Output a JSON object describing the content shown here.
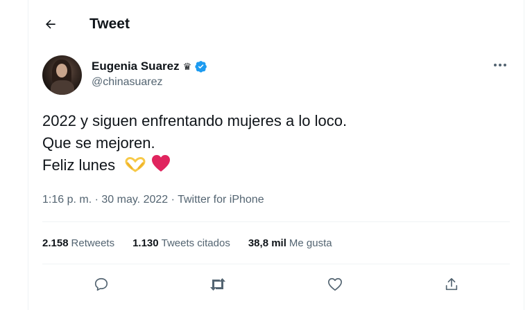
{
  "header": {
    "title": "Tweet",
    "back_icon": "arrow-left-icon"
  },
  "author": {
    "name": "Eugenia Suarez",
    "crown": "♛",
    "verified_icon": "verified-badge-icon",
    "handle": "@chinasuarez",
    "avatar_icon": "profile-photo"
  },
  "tweet": {
    "lines": [
      "2022 y siguen enfrentando mujeres a lo loco.",
      "Que se mejoren.",
      "Feliz lunes"
    ],
    "emojis": [
      "heart-hands-emoji",
      "red-heart-emoji"
    ],
    "time": "1:16 p. m.",
    "date": "30 may. 2022",
    "separator": "·",
    "source": "Twitter for iPhone"
  },
  "stats": {
    "retweets_count": "2.158",
    "retweets_label": "Retweets",
    "quotes_count": "1.130",
    "quotes_label": "Tweets citados",
    "likes_count": "38,8 mil",
    "likes_label": "Me gusta"
  },
  "actions": [
    "reply-icon",
    "retweet-icon",
    "like-icon",
    "share-icon"
  ],
  "colors": {
    "text": "#0f1419",
    "secondary": "#536471",
    "verified": "#1d9bf0",
    "divider": "#eff3f4",
    "heart": "#e0245e"
  }
}
